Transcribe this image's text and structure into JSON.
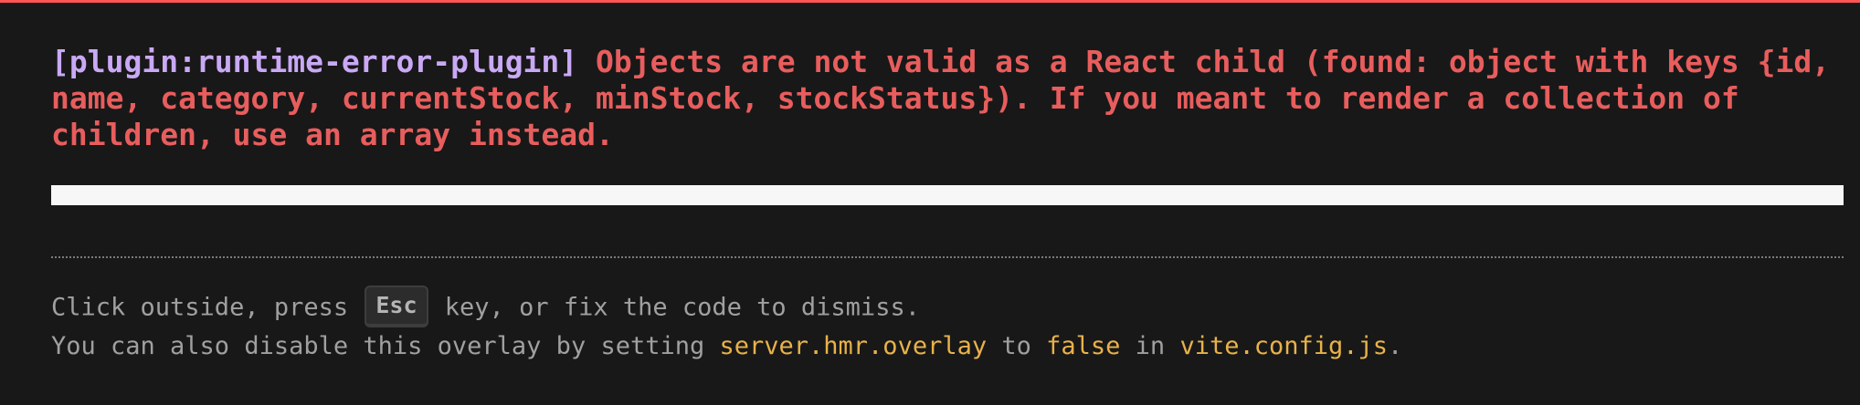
{
  "error": {
    "plugin": "[plugin:runtime-error-plugin]",
    "message": "Objects are not valid as a React child (found: object with keys {id,\nname, category, currentStock, minStock, stockStatus}). If you meant to render a collection of\nchildren, use an array instead."
  },
  "tip": {
    "line1_before": "Click outside, press ",
    "key": "Esc",
    "line1_after": " key, or fix the code to dismiss.",
    "line2_prefix": "You can also disable this overlay by setting ",
    "setting": "server.hmr.overlay",
    "line2_to": " to ",
    "value": "false",
    "line2_in": " in ",
    "file": "vite.config.js",
    "line2_end": "."
  },
  "colors": {
    "error_red": "#e85d5d",
    "plugin_purple": "#c9a9f5",
    "code_yellow": "#e8b24a",
    "top_border": "#ff5555"
  }
}
